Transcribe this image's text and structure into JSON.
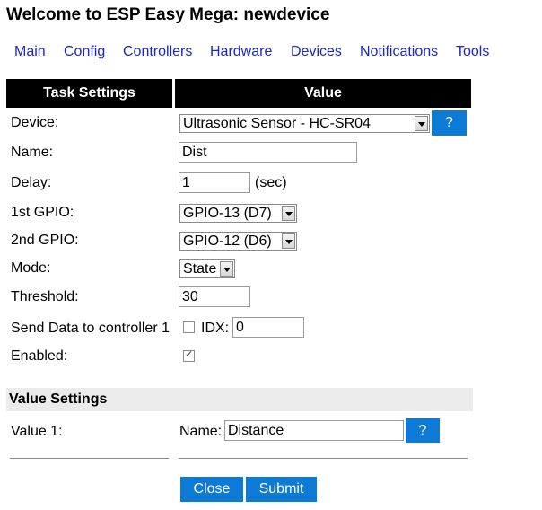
{
  "page": {
    "title": "Welcome to ESP Easy Mega: newdevice"
  },
  "nav": {
    "items": [
      "Main",
      "Config",
      "Controllers",
      "Hardware",
      "Devices",
      "Notifications",
      "Tools"
    ]
  },
  "table": {
    "col_task": "Task Settings",
    "col_value": "Value"
  },
  "task": {
    "device": {
      "label": "Device:",
      "value": "Ultrasonic Sensor - HC-SR04",
      "help": "?"
    },
    "name": {
      "label": "Name:",
      "value": "Dist"
    },
    "delay": {
      "label": "Delay:",
      "value": "1",
      "unit": "(sec)"
    },
    "gpio1": {
      "label": "1st GPIO:",
      "value": "GPIO-13 (D7)"
    },
    "gpio2": {
      "label": "2nd GPIO:",
      "value": "GPIO-12 (D6)"
    },
    "mode": {
      "label": "Mode:",
      "value": "State"
    },
    "threshold": {
      "label": "Threshold:",
      "value": "30"
    },
    "send": {
      "label": "Send Data to controller 1",
      "checked": false,
      "idx_label": "IDX:",
      "idx_value": "0"
    },
    "enabled": {
      "label": "Enabled:",
      "checked": true
    }
  },
  "value_settings": {
    "title": "Value Settings",
    "value1": {
      "label": "Value 1:",
      "name_label": "Name:",
      "name_value": "Distance",
      "help": "?"
    }
  },
  "buttons": {
    "close": "Close",
    "submit": "Submit"
  },
  "colors": {
    "accent": "#0d7ad6",
    "link": "#1a26c8",
    "header_bg": "#000000"
  }
}
